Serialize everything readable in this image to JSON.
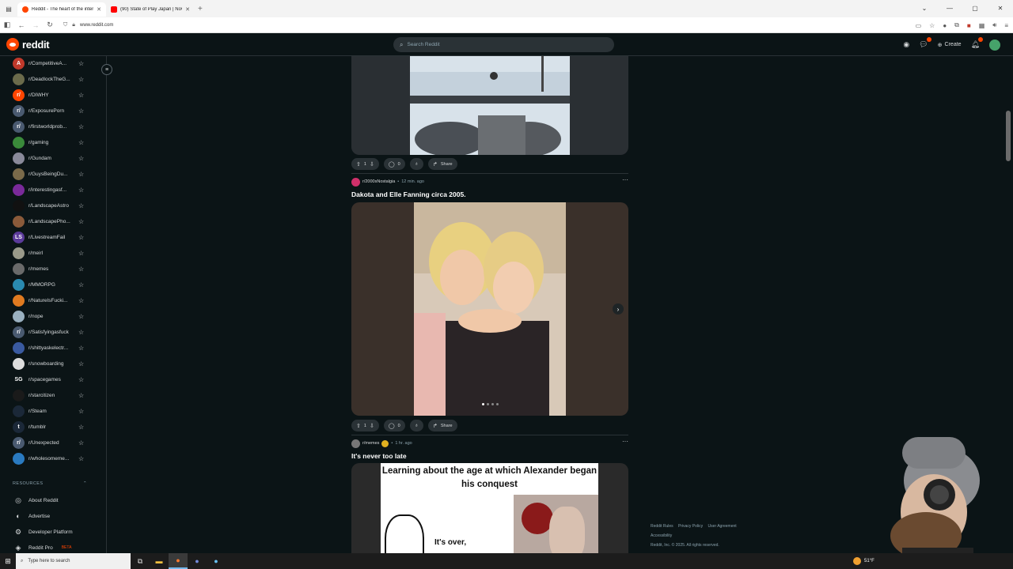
{
  "browser": {
    "tabs": [
      {
        "title": "Reddit - The heart of the intern",
        "color": "#ff4500",
        "active": true
      },
      {
        "title": "(90) State of Play Japan | Novem",
        "color": "#ff0000",
        "active": false
      }
    ],
    "url": "www.reddit.com"
  },
  "header": {
    "logo_text": "reddit",
    "search_placeholder": "Search Reddit",
    "create_label": "Create",
    "chat_badge": "1",
    "notif_badge": "1"
  },
  "sidebar": {
    "subreddits": [
      {
        "name": "r/CompetitiveA...",
        "color": "#c0392b",
        "glyph": "A"
      },
      {
        "name": "r/DeadlockTheG...",
        "color": "#6b6b4b",
        "glyph": ""
      },
      {
        "name": "r/DIWHY",
        "color": "#ff4500",
        "glyph": "r/"
      },
      {
        "name": "r/ExposurePorn",
        "color": "#4a5a70",
        "glyph": "r/"
      },
      {
        "name": "r/firstworldprob...",
        "color": "#4a5a70",
        "glyph": "r/"
      },
      {
        "name": "r/gaming",
        "color": "#3a8a3a",
        "glyph": ""
      },
      {
        "name": "r/Gundam",
        "color": "#8a8a9a",
        "glyph": ""
      },
      {
        "name": "r/GuysBeingDu...",
        "color": "#7a6a4a",
        "glyph": ""
      },
      {
        "name": "r/interestingasf...",
        "color": "#7a2a9a",
        "glyph": ""
      },
      {
        "name": "r/LandscapeAstro",
        "color": "#111111",
        "glyph": ""
      },
      {
        "name": "r/LandscapePho...",
        "color": "#8a5a3a",
        "glyph": ""
      },
      {
        "name": "r/LivestreamFail",
        "color": "#5b3a9a",
        "glyph": "LS"
      },
      {
        "name": "r/meirl",
        "color": "#9a9a8a",
        "glyph": ""
      },
      {
        "name": "r/memes",
        "color": "#6a6a6a",
        "glyph": ""
      },
      {
        "name": "r/MMORPG",
        "color": "#2a8ab0",
        "glyph": ""
      },
      {
        "name": "r/NatureIsFucki...",
        "color": "#e07a20",
        "glyph": ""
      },
      {
        "name": "r/nope",
        "color": "#9ab0c0",
        "glyph": ""
      },
      {
        "name": "r/Satisfyingasfuck",
        "color": "#4a5a70",
        "glyph": "r/"
      },
      {
        "name": "r/shittyaskelectr...",
        "color": "#3a5aa0",
        "glyph": ""
      },
      {
        "name": "r/snowboarding",
        "color": "#dddddd",
        "glyph": ""
      },
      {
        "name": "r/spacegames",
        "color": "#0b1416",
        "glyph": "SG"
      },
      {
        "name": "r/starcitizen",
        "color": "#1a1a1a",
        "glyph": ""
      },
      {
        "name": "r/Steam",
        "color": "#1b2838",
        "glyph": ""
      },
      {
        "name": "r/tumblr",
        "color": "#1b2838",
        "glyph": "t"
      },
      {
        "name": "r/Unexpected",
        "color": "#4a5a70",
        "glyph": "r/"
      },
      {
        "name": "r/wholesomeme...",
        "color": "#2a7ac0",
        "glyph": ""
      }
    ],
    "resources_heading": "RESOURCES",
    "resources": [
      {
        "label": "About Reddit",
        "icon": "reddit-icon"
      },
      {
        "label": "Advertise",
        "icon": "megaphone-icon"
      },
      {
        "label": "Developer Platform",
        "icon": "code-icon"
      },
      {
        "label": "Reddit Pro",
        "icon": "pro-icon",
        "tag": "BETA"
      }
    ]
  },
  "feed": {
    "post1": {
      "votes": "1",
      "comments": "0",
      "share": "Share"
    },
    "post2": {
      "subreddit": "r/2000sNostalgia",
      "time": "12 min. ago",
      "title": "Dakota and Elle Fanning circa 2005.",
      "votes": "1",
      "comments": "0",
      "share": "Share"
    },
    "post3": {
      "subreddit": "r/memes",
      "time": "1 hr. ago",
      "title": "It's never too late",
      "meme_top": "Learning about the age at which Alexander began his conquest",
      "meme_caption": "It's over,"
    }
  },
  "footer": {
    "links": [
      "Reddit Rules",
      "Privacy Policy",
      "User Agreement"
    ],
    "accessibility": "Accessibility",
    "copyright": "Reddit, Inc. © 2025. All rights reserved."
  },
  "taskbar": {
    "search_placeholder": "Type here to search",
    "weather": "51°F"
  }
}
